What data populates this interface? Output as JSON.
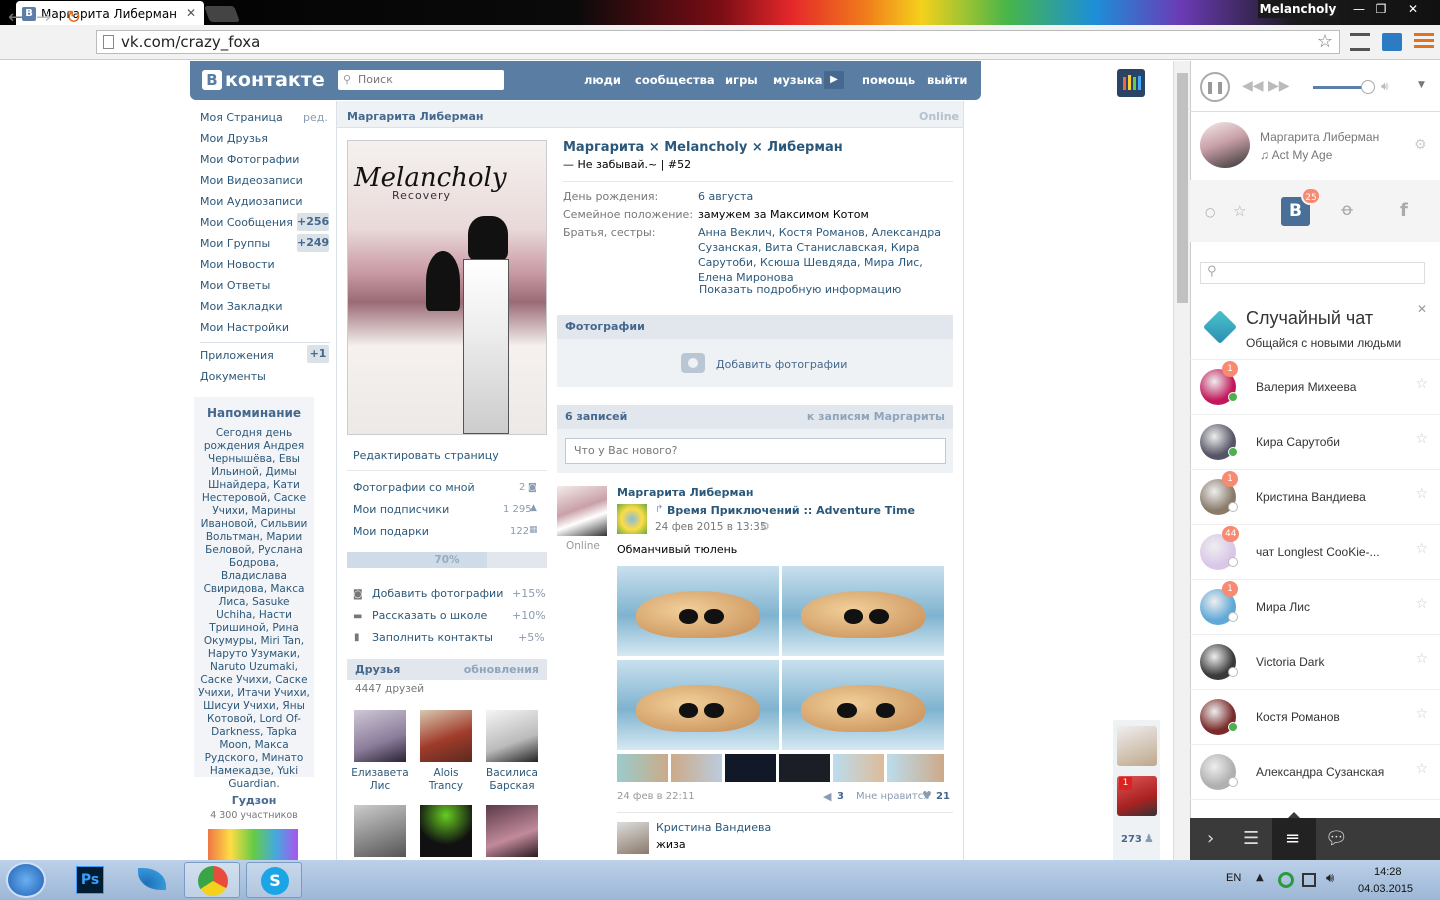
{
  "browser": {
    "tab_title": "Маргарита Либерман",
    "profile_name": "Melancholy",
    "url": "vk.com/crazy_foxa"
  },
  "vk": {
    "logo_text": "контакте",
    "logo_letter": "В",
    "search_placeholder": "Поиск",
    "menu": [
      "люди",
      "сообщества",
      "игры",
      "музыка",
      "помощь",
      "выйти"
    ]
  },
  "left_nav": {
    "items": [
      {
        "label": "Моя Страница",
        "extra": "ред."
      },
      {
        "label": "Мои Друзья"
      },
      {
        "label": "Мои Фотографии"
      },
      {
        "label": "Мои Видеозаписи"
      },
      {
        "label": "Мои Аудиозаписи"
      },
      {
        "label": "Мои Сообщения",
        "count": "+256"
      },
      {
        "label": "Мои Группы",
        "count": "+249"
      },
      {
        "label": "Мои Новости"
      },
      {
        "label": "Мои Ответы"
      },
      {
        "label": "Мои Закладки"
      },
      {
        "label": "Мои Настройки"
      }
    ],
    "apps": {
      "label": "Приложения",
      "count": "+1"
    },
    "docs": "Документы"
  },
  "reminder": {
    "title": "Напоминание",
    "text": "Сегодня день рождения Андрея Чернышёва, Евы Ильиной, Димы Шнайдера, Кати Нестеровой, Саске Учихи, Марины Ивановой, Сильвии Вольтман, Марии Беловой, Руслана Бодрова, Владислава Свиридова, Макса Лиса, Sasuke Uchiha, Насти Тришиной, Рина Окумуры, Miri Tan, Наруто Узумаки, Naruto Uzumaki, Саске Учихи, Саске Учихи, Итачи Учихи, Шисуи Учихи, Яны Котовой, Lord Of-Darkness, Tapka Moon, Макса Рудского, Минато Намекадзе, Yuki Guardian."
  },
  "group": {
    "name": "Гудзон",
    "members": "4 300 участников"
  },
  "profile": {
    "header_name": "Маргарита Либерман",
    "header_status": "Online",
    "avatar_title": "Melancholy",
    "avatar_subtitle": "Recovery",
    "full_name": "Маргарита × Melancholy × Либерман",
    "status": "— Не забывай.~ | #52",
    "info": [
      {
        "label": "День рождения:",
        "value": "6 августа"
      },
      {
        "label": "Семейное положение:",
        "value": "замужем за Максимом Котом"
      },
      {
        "label": "Братья, сестры:",
        "value": "Анна Веклич, Костя Романов, Александра Сузанская, Вита Станиславская, Кира Сарутоби, Ксюша Шевдяда, Мира Лис, Елена Миронова"
      }
    ],
    "more_info": "Показать подробную информацию",
    "edit_page": "Редактировать страницу",
    "links": [
      {
        "label": "Фотографии со мной",
        "count": "2"
      },
      {
        "label": "Мои подписчики",
        "count": "1 295"
      },
      {
        "label": "Мои подарки",
        "count": "122"
      }
    ],
    "progress": {
      "label": "70%",
      "value": 0.7
    },
    "boosts": [
      {
        "label": "Добавить фотографии",
        "pct": "+15%"
      },
      {
        "label": "Рассказать о школе",
        "pct": "+10%"
      },
      {
        "label": "Заполнить контакты",
        "pct": "+5%"
      }
    ],
    "friends": {
      "title": "Друзья",
      "updates": "обновления",
      "count": "4447 друзей",
      "items": [
        {
          "first": "Елизавета",
          "last": "Лис"
        },
        {
          "first": "Alois",
          "last": "Trancy"
        },
        {
          "first": "Василиса",
          "last": "Барская"
        }
      ]
    }
  },
  "photos": {
    "title": "Фотографии",
    "add": "Добавить фотографии"
  },
  "wall": {
    "count": "6 записей",
    "to_posts": "к записям Маргариты",
    "input_placeholder": "Что у Вас нового?",
    "post": {
      "author": "Маргарита Либерман",
      "author_status": "Online",
      "repost_title": "Время Приключений :: Adventure Time",
      "repost_date": "24 фев 2015 в 13:35",
      "text": "Обманчивый тюлень",
      "date": "24 фев в 22:11",
      "reposts": "3",
      "likes_label": "Мне нравится",
      "likes": "21"
    },
    "comment": {
      "author": "Кристина Вандиева",
      "text": "жиза"
    }
  },
  "right_col": {
    "count": "273",
    "badge": "1"
  },
  "panel": {
    "track_artist": "Маргарита Либерман",
    "track_title": "Act My Age",
    "vk_badge": "25",
    "random_chat_title": "Случайный чат",
    "random_chat_sub": "Общайся с новыми людьми",
    "chats": [
      {
        "name": "Валерия Михеева",
        "badge": "1",
        "online": true,
        "color": "#c2185b"
      },
      {
        "name": "Кира Сарутоби",
        "badge": "",
        "online": true,
        "color": "#555566"
      },
      {
        "name": "Кристина Вандиева",
        "badge": "1",
        "online": false,
        "color": "#8a7a6a"
      },
      {
        "name": "чат Longlest CooKie-...",
        "badge": "44",
        "online": false,
        "color": "#d9c7e8"
      },
      {
        "name": "Мира Лис",
        "badge": "1",
        "online": false,
        "color": "#5fa8d8"
      },
      {
        "name": "Victoria Dark",
        "badge": "",
        "online": false,
        "color": "#3a3a3a"
      },
      {
        "name": "Костя Романов",
        "badge": "",
        "online": true,
        "color": "#7a2a2a"
      },
      {
        "name": "Александра Сузанская",
        "badge": "",
        "online": false,
        "color": "#b0b0b0"
      }
    ]
  },
  "taskbar": {
    "lang": "EN",
    "time": "14:28",
    "date": "04.03.2015"
  }
}
